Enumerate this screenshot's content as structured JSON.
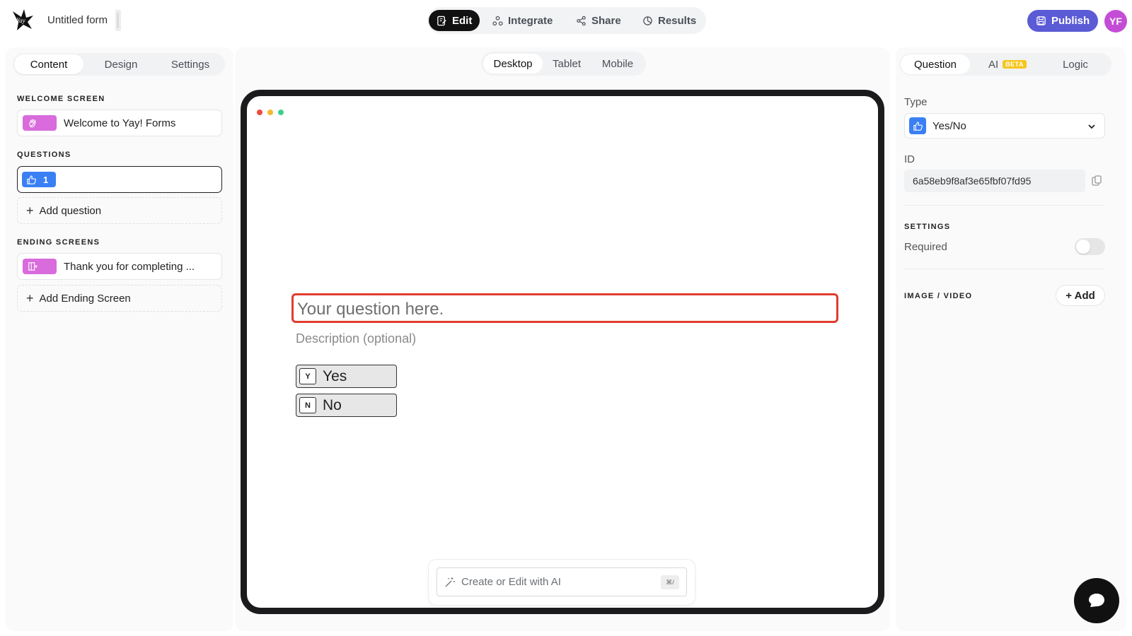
{
  "header": {
    "form_title": "Untitled form",
    "modes": {
      "edit": "Edit",
      "integrate": "Integrate",
      "share": "Share",
      "results": "Results"
    },
    "publish_label": "Publish",
    "avatar_initials": "YF"
  },
  "left_panel": {
    "tabs": {
      "content": "Content",
      "design": "Design",
      "settings": "Settings"
    },
    "welcome_heading": "WELCOME SCREEN",
    "welcome_item": "Welcome to Yay! Forms",
    "questions_heading": "QUESTIONS",
    "question_number": "1",
    "add_question": "Add question",
    "ending_heading": "ENDING SCREENS",
    "ending_item": "Thank you for completing ...",
    "add_ending": "Add Ending Screen"
  },
  "canvas": {
    "devices": {
      "desktop": "Desktop",
      "tablet": "Tablet",
      "mobile": "Mobile"
    },
    "question_placeholder": "Your question here.",
    "description_placeholder": "Description (optional)",
    "choices": [
      {
        "key": "Y",
        "label": "Yes"
      },
      {
        "key": "N",
        "label": "No"
      }
    ],
    "ai_prompt": "Create or Edit with AI",
    "ai_shortcut": "⌘/"
  },
  "right_panel": {
    "tabs": {
      "question": "Question",
      "ai": "AI",
      "ai_badge": "BETA",
      "logic": "Logic"
    },
    "type_label": "Type",
    "type_value": "Yes/No",
    "id_label": "ID",
    "id_value": "6a58eb9f8af3e65fbf07fd95",
    "settings_heading": "SETTINGS",
    "required_label": "Required",
    "required_on": false,
    "media_heading": "IMAGE / VIDEO",
    "add_media": "+ Add"
  },
  "colors": {
    "accent": "#5b5bd6",
    "avatar": "#c44dd6",
    "question_highlight": "#e03d2e",
    "chip_pink": "#d96bdc",
    "chip_blue": "#3b7ff5"
  }
}
